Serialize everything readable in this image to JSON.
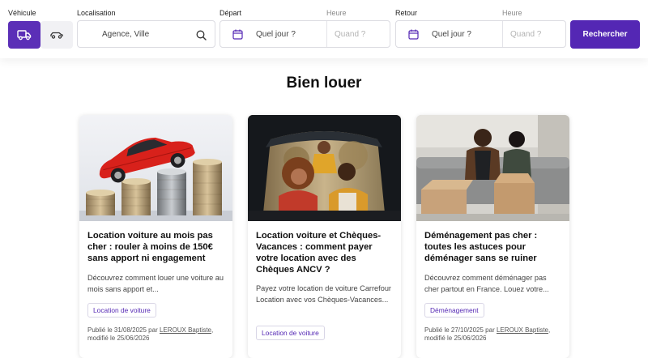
{
  "search": {
    "vehicle_label": "Véhicule",
    "location_label": "Localisation",
    "location_placeholder": "Agence, Ville",
    "departure_label": "Départ",
    "departure_time_label": "Heure",
    "departure_date_placeholder": "Quel jour ?",
    "departure_time_placeholder": "Quand ?",
    "return_label": "Retour",
    "return_time_label": "Heure",
    "return_date_placeholder": "Quel jour ?",
    "return_time_placeholder": "Quand ?",
    "submit_label": "Rechercher",
    "vehicle_options": [
      "truck-icon",
      "car-icon"
    ],
    "accent_color": "#5427b4"
  },
  "page": {
    "title": "Bien louer"
  },
  "cards": [
    {
      "title": "Location voiture au mois pas cher : rouler à moins de 150€ sans apport ni engagement",
      "description": "Découvrez comment louer une voiture au mois sans apport et...",
      "tag": "Location de voiture",
      "meta_prefix": "Publié le 31/08/2025 par ",
      "author": "LEROUX Baptiste",
      "meta_suffix": ", modifié le 25/06/2026",
      "image": "red-car-on-coin-stacks"
    },
    {
      "title": "Location voiture et Chèques-Vacances : comment payer votre location avec des Chèques ANCV ?",
      "description": "Payez votre location de voiture Carrefour Location avec vos Chèques-Vacances...",
      "tag": "Location de voiture",
      "image": "family-in-car-trunk"
    },
    {
      "title": "Déménagement pas cher : toutes les astuces pour déménager sans se ruiner",
      "description": "Découvrez comment déménager pas cher partout en France. Louez votre...",
      "tag": "Déménagement",
      "meta_prefix": "Publié le 27/10/2025 par ",
      "author": "LEROUX Baptiste",
      "meta_suffix": ", modifié le 25/06/2026",
      "image": "couple-unpacking-boxes"
    }
  ]
}
